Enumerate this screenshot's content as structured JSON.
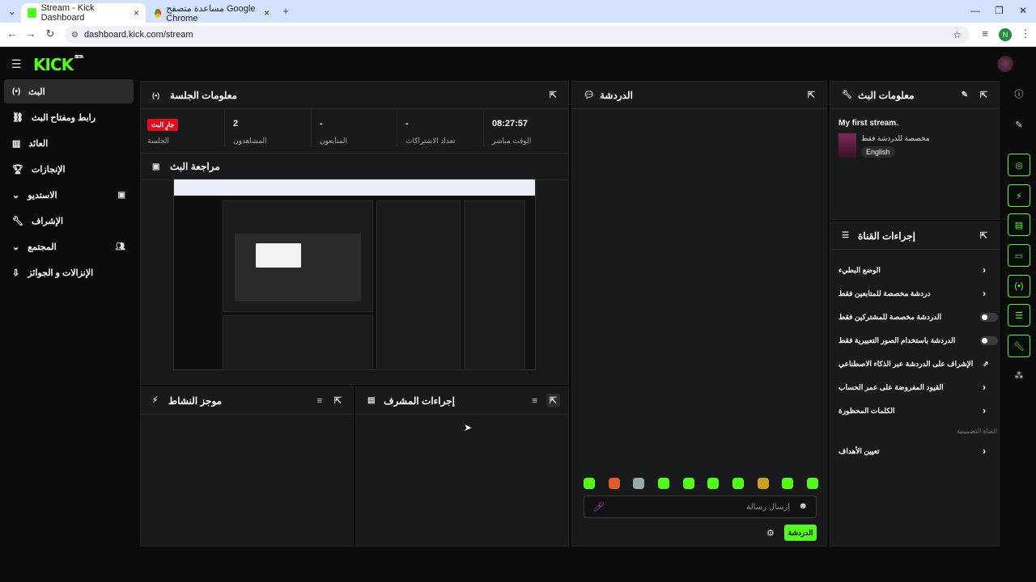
{
  "browser": {
    "tabs": [
      {
        "label": "Stream - Kick Dashboard",
        "active": true
      },
      {
        "label": "مساعدة متصفح Google Chrome",
        "active": false
      }
    ],
    "url": "dashboard.kick.com/stream",
    "profile_initial": "N"
  },
  "app": {
    "logo": "KICK",
    "logo_tag": "BETA"
  },
  "sidebar": {
    "items": [
      {
        "label": "البث",
        "icon": "broadcast-icon",
        "active": true
      },
      {
        "label": "رابط ومفتاح البث",
        "icon": "link-icon",
        "active": false
      },
      {
        "label": "العائد",
        "icon": "bar-chart-icon",
        "active": false
      },
      {
        "label": "الإنجازات",
        "icon": "trophy-icon",
        "active": false
      },
      {
        "label": "الاستديو",
        "icon": "studio-icon",
        "active": false
      },
      {
        "label": "الإشراف",
        "icon": "wrench-icon",
        "active": false
      },
      {
        "label": "المجتمع",
        "icon": "community-icon",
        "active": false
      },
      {
        "label": "الإنزالات و الجوائز",
        "icon": "drops-icon",
        "active": false
      }
    ]
  },
  "session": {
    "title": "معلومات الجلسة",
    "live_badge": "جارٍ البث",
    "stats": [
      {
        "label": "الجلسة",
        "value": ""
      },
      {
        "label": "المشاهدون",
        "value": "2"
      },
      {
        "label": "المتابعون",
        "value": "-"
      },
      {
        "label": "تعداد الاشتراكات",
        "value": "-"
      },
      {
        "label": "الوقت مباشر",
        "value": "08:27:57"
      }
    ]
  },
  "review": {
    "title": "مراجعة البث"
  },
  "activity": {
    "title": "موجز النشاط"
  },
  "modactions": {
    "title": "إجراءات المشرف"
  },
  "chat": {
    "title": "الدردشة",
    "placeholder": "إرسال رسالة",
    "send_label": "الدردشة"
  },
  "streaminfo": {
    "title": "معلومات البث",
    "stream_title": "My first stream.",
    "category": "مخصصة للدردشة فقط",
    "language": "English"
  },
  "channel_actions": {
    "title": "إجراءات القناة",
    "items": [
      {
        "label": "الوضع البطيء",
        "control": "chevron"
      },
      {
        "label": "دردشة مخصصة للمتابعين فقط",
        "control": "chevron"
      },
      {
        "label": "الدردشة مخصصة للمشتركين فقط",
        "control": "toggle"
      },
      {
        "label": "الدردشة باستخدام الصور التعبيرية فقط",
        "control": "toggle"
      },
      {
        "label": "الإشراف على الدردشة عبر الذكاء الاصطناعي",
        "control": "external"
      },
      {
        "label": "القيود المفروضة على عمر الحساب",
        "control": "chevron"
      },
      {
        "label": "الكلمات المحظورة",
        "control": "chevron"
      }
    ],
    "section_label": "القناة التضمينية",
    "extra_item": {
      "label": "تعيين الأهداف",
      "control": "chevron"
    }
  },
  "colors": {
    "accent": "#53fc18",
    "live": "#e00d1c",
    "panel": "#18191b",
    "bg": "#0b0b0c"
  }
}
